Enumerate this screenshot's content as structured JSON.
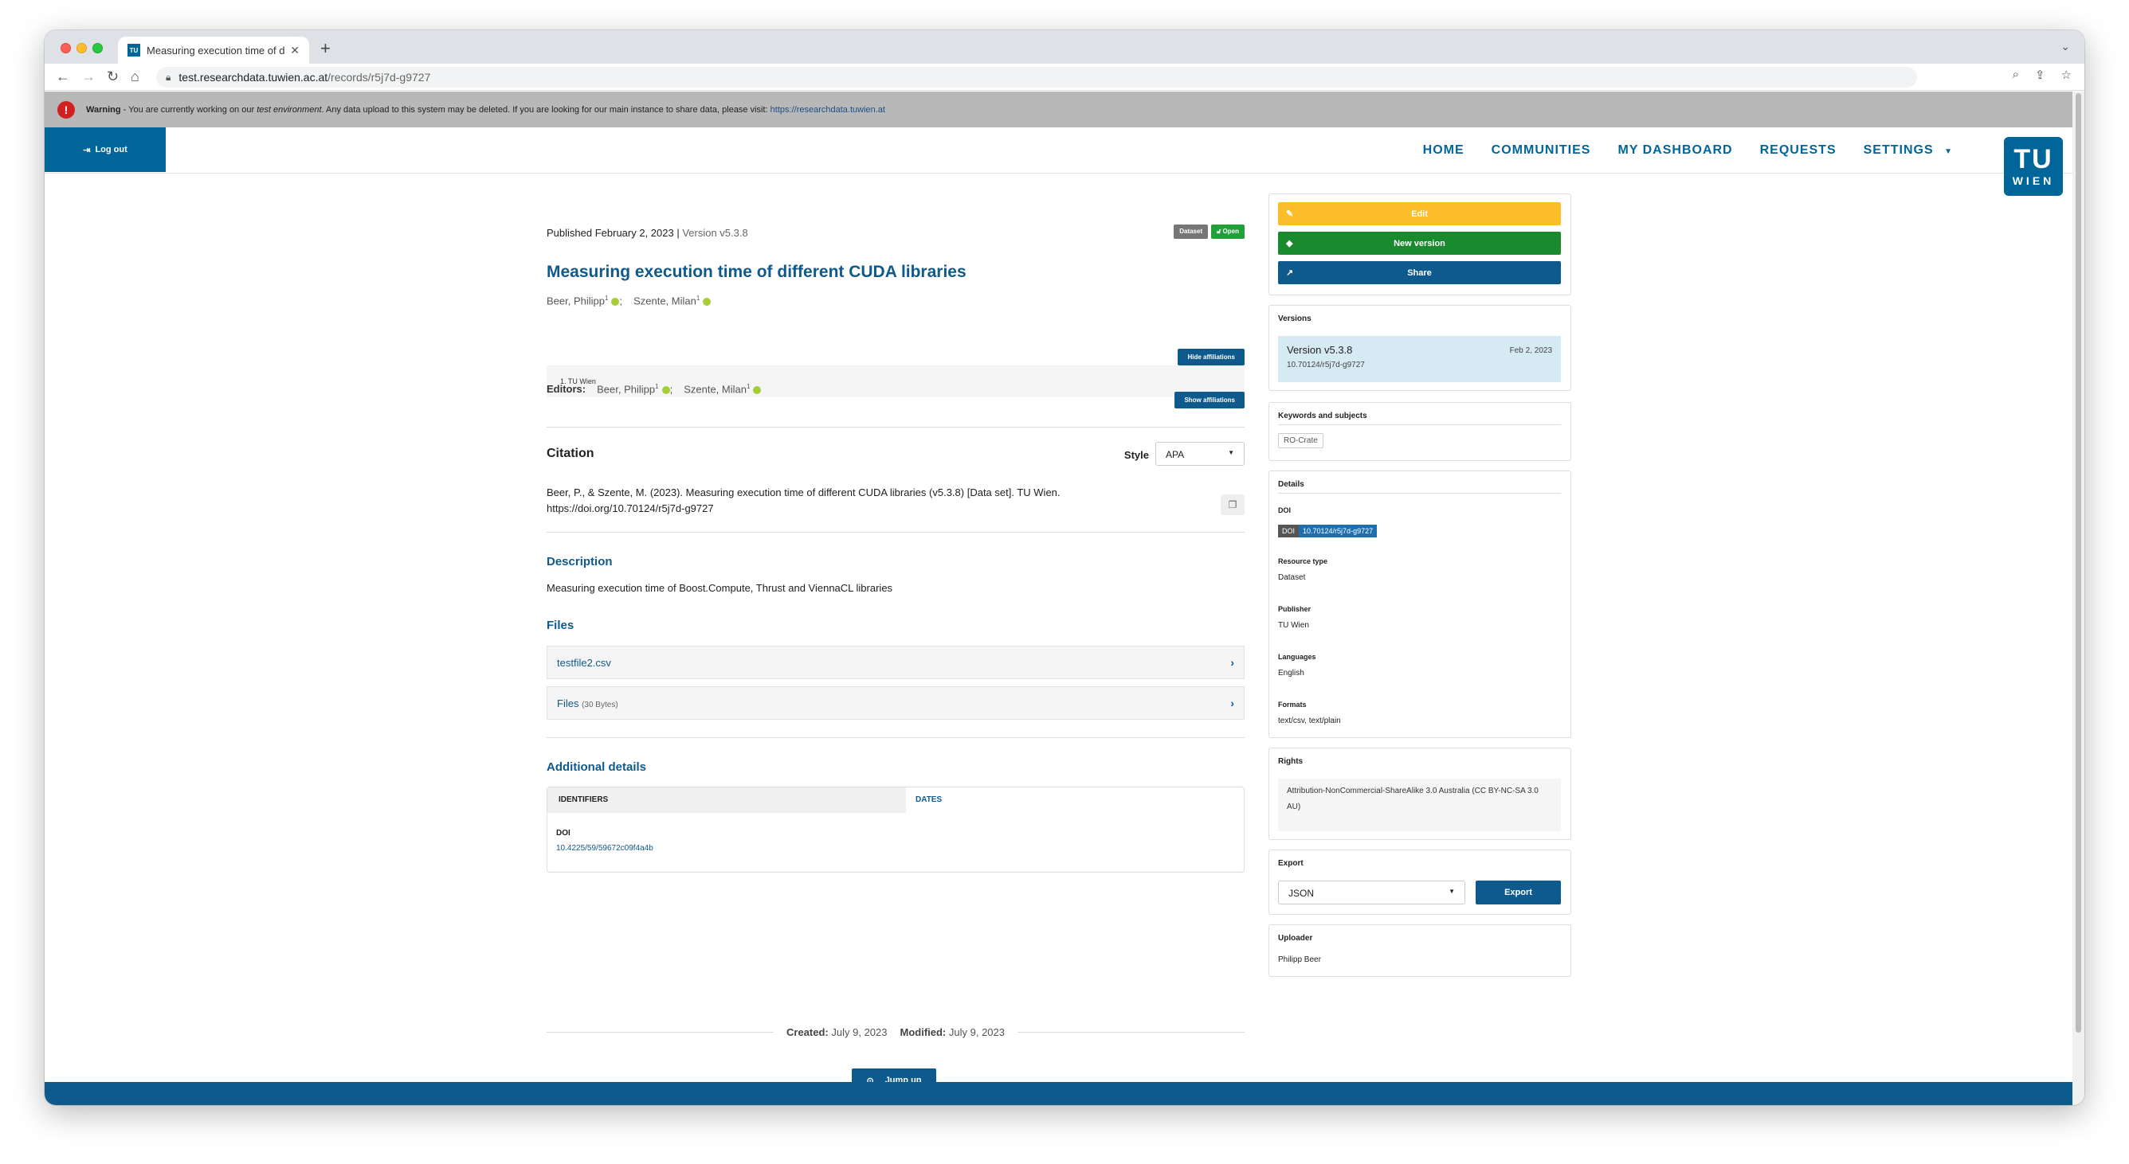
{
  "browser": {
    "tab_title": "Measuring execution time of di",
    "tab_favicon": "TU",
    "url_host": "test.researchdata.tuwien.ac.at",
    "url_path": "/records/r5j7d-g9727"
  },
  "warning": {
    "label": "Warning",
    "text": " - You are currently working on our ",
    "em": "test environment",
    "text2": ". Any data upload to this system may be deleted. If you are looking for our main instance to share data, please visit: ",
    "link": "https://researchdata.tuwien.at"
  },
  "header": {
    "logout": "Log out",
    "nav": [
      "HOME",
      "COMMUNITIES",
      "MY DASHBOARD",
      "REQUESTS",
      "SETTINGS"
    ],
    "logo_top": "TU",
    "logo_bottom": "WIEN"
  },
  "record": {
    "published": "Published February 2, 2023",
    "version": "Version v5.3.8",
    "badge_type": "Dataset",
    "badge_access": "Open",
    "title": "Measuring execution time of different CUDA libraries",
    "creators": [
      {
        "name": "Beer, Philipp",
        "sup": "1",
        "sep": ";"
      },
      {
        "name": "Szente, Milan",
        "sup": "1",
        "sep": ""
      }
    ],
    "hide_affiliations": "Hide affiliations",
    "affiliation": "1. TU Wien",
    "editors_label": "Editors:",
    "editors": [
      {
        "name": "Beer, Philipp",
        "sup": "1",
        "sep": ";"
      },
      {
        "name": "Szente, Milan",
        "sup": "1",
        "sep": ""
      }
    ],
    "show_affiliations": "Show affiliations",
    "citation_heading": "Citation",
    "style_label": "Style",
    "style_value": "APA",
    "citation_text": "Beer, P., & Szente, M. (2023). Measuring execution time of different CUDA libraries (v5.3.8) [Data set]. TU Wien. https://doi.org/10.70124/r5j7d-g9727",
    "description_heading": "Description",
    "description": "Measuring execution time of Boost.Compute, Thrust and ViennaCL libraries",
    "files_heading": "Files",
    "files": [
      {
        "name": "testfile2.csv",
        "size": ""
      },
      {
        "name": "Files",
        "size": "(30 Bytes)"
      }
    ],
    "additional_heading": "Additional details",
    "tab_identifiers": "IDENTIFIERS",
    "tab_dates": "DATES",
    "id_label": "DOI",
    "id_value": "10.4225/59/59672c09f4a4b",
    "created_label": "Created:",
    "created_value": "July 9, 2023",
    "modified_label": "Modified:",
    "modified_value": "July 9, 2023",
    "jump_up": "Jump up"
  },
  "sidebar": {
    "edit": "Edit",
    "new_version": "New version",
    "share": "Share",
    "versions_title": "Versions",
    "version_name": "Version v5.3.8",
    "version_date": "Feb 2, 2023",
    "version_doi": "10.70124/r5j7d-g9727",
    "keywords_title": "Keywords and subjects",
    "keyword": "RO-Crate",
    "details_title": "Details",
    "doi_label": "DOI",
    "doi_badge_left": "DOI",
    "doi_badge_right": "10.70124/r5j7d-g9727",
    "resource_type_label": "Resource type",
    "resource_type": "Dataset",
    "publisher_label": "Publisher",
    "publisher": "TU Wien",
    "languages_label": "Languages",
    "languages": "English",
    "formats_label": "Formats",
    "formats": "text/csv, text/plain",
    "rights_title": "Rights",
    "rights": "Attribution-NonCommercial-ShareAlike 3.0 Australia (CC BY-NC-SA 3.0 AU)",
    "export_title": "Export",
    "export_format": "JSON",
    "export_button": "Export",
    "uploader_title": "Uploader",
    "uploader": "Philipp Beer"
  },
  "colors": {
    "primary": "#0f5a8c",
    "edit": "#fbbd2a",
    "new_version": "#1a8a2e",
    "warning_bg": "#b8b8b8"
  }
}
